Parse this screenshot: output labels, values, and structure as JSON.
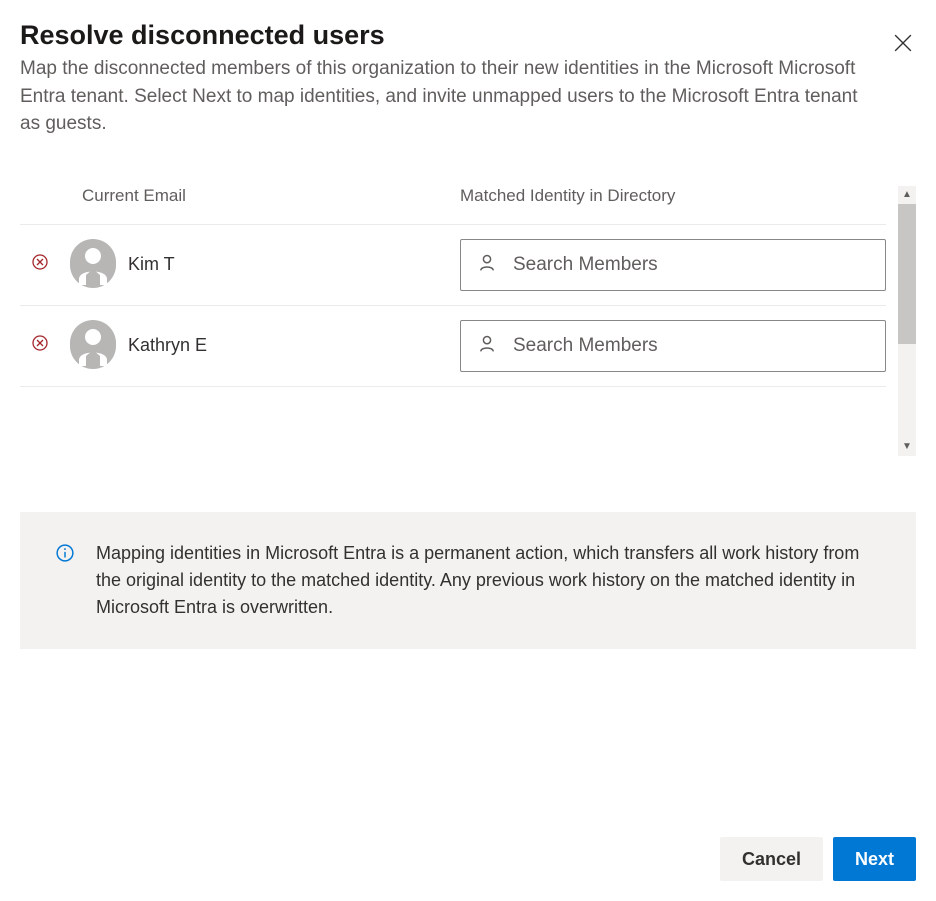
{
  "header": {
    "title": "Resolve disconnected users",
    "subtitle": "Map the disconnected members of this organization to their new identities in the Microsoft Microsoft Entra tenant. Select Next to map identities, and invite unmapped users to the Microsoft Entra tenant as guests."
  },
  "columns": {
    "email": "Current Email",
    "identity": "Matched Identity in Directory"
  },
  "users": [
    {
      "name": "Kim T",
      "search_placeholder": "Search Members"
    },
    {
      "name": "Kathryn E",
      "search_placeholder": "Search Members"
    }
  ],
  "info": {
    "text": "Mapping identities in Microsoft Entra is a permanent action, which transfers all work history from the original identity to the matched identity. Any previous work history on the matched identity in Microsoft Entra is overwritten."
  },
  "footer": {
    "cancel": "Cancel",
    "next": "Next"
  }
}
